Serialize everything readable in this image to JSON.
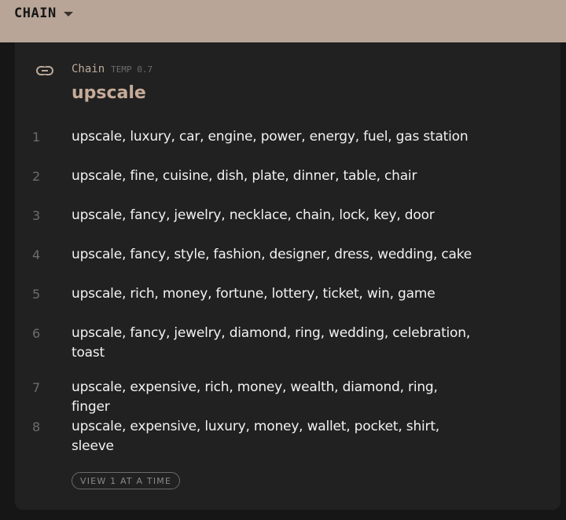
{
  "header": {
    "title": "CHAIN"
  },
  "card": {
    "chain_label": "Chain",
    "temp_label": "TEMP 0.7",
    "word": "upscale",
    "rows": [
      {
        "num": "1",
        "text": "upscale, luxury, car, engine, power, energy, fuel, gas station"
      },
      {
        "num": "2",
        "text": "upscale, fine, cuisine, dish, plate, dinner, table, chair"
      },
      {
        "num": "3",
        "text": "upscale, fancy, jewelry, necklace, chain, lock, key, door"
      },
      {
        "num": "4",
        "text": "upscale, fancy, style, fashion, designer, dress, wedding, cake"
      },
      {
        "num": "5",
        "text": "upscale, rich, money, fortune, lottery, ticket, win, game"
      },
      {
        "num": "6",
        "text": "upscale, fancy, jewelry, diamond, ring, wedding, celebration, toast"
      },
      {
        "num": "7",
        "text": "upscale, expensive, rich, money, wealth, diamond, ring, finger"
      },
      {
        "num": "8",
        "text": "upscale, expensive, luxury, money, wallet, pocket, shirt, sleeve"
      }
    ],
    "view_button": "VIEW 1 AT A TIME"
  }
}
